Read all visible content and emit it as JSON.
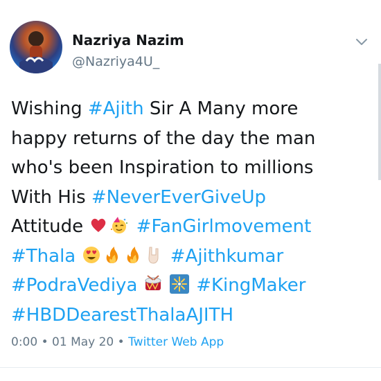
{
  "user": {
    "name": "Nazriya Nazim",
    "handle": "@Nazriya4U_"
  },
  "tweet": {
    "line1": {
      "pre": "Wishing ",
      "tag": "#Ajith",
      "post": " Sir  A Many more"
    },
    "line2": "happy returns of the day the man",
    "line3": "who's been Inspiration to millions",
    "line4": {
      "pre": "With His ",
      "tag": "#NeverEverGiveUp"
    },
    "line5": {
      "pre": "Attitude ",
      "tag": "#FanGirlmovement"
    },
    "line6": {
      "tag1": "#Thala",
      "tag2": "#Ajithkumar"
    },
    "line7": {
      "tag1": "#PodraVediya",
      "tag2": "#KingMaker"
    },
    "line8": {
      "tag": "#HBDDearestThalaAJITH"
    },
    "emojis": [
      "red-heart",
      "party-face",
      "heart-eyes",
      "fire",
      "fire",
      "sign-of-horns",
      "drum",
      "fireworks"
    ]
  },
  "meta": {
    "time": "0:00",
    "sep1": " • ",
    "date": "01 May 20",
    "sep2": " • ",
    "source": "Twitter Web App"
  },
  "colors": {
    "link": "#1da1f2",
    "text": "#14171a",
    "secondary": "#657786"
  }
}
